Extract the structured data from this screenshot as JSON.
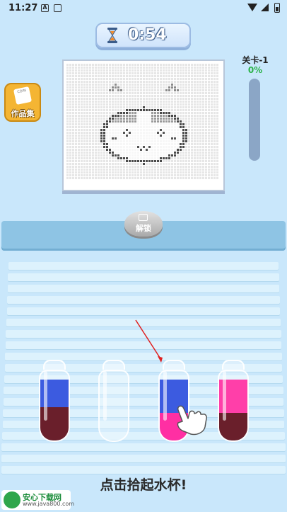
{
  "status_bar": {
    "time": "11:27",
    "icon_a": "A",
    "icons": [
      "notification-a-icon",
      "screenshot-icon",
      "wifi-icon",
      "signal-icon",
      "battery-icon"
    ]
  },
  "timer": {
    "text": "0:54",
    "icon": "hourglass-icon"
  },
  "gallery_button": {
    "label": "作品集",
    "icon": "coin-book-icon",
    "badge": "COIN"
  },
  "level": {
    "label": "关卡-1",
    "percent_text": "0%",
    "progress": 0
  },
  "unlock_button": {
    "label": "解锁",
    "icon": "video-icon"
  },
  "tubes": [
    {
      "layers": [
        {
          "color": "#6a1f2b",
          "fraction": 0.55
        },
        {
          "color": "#3c5be0",
          "fraction": 0.45
        }
      ]
    },
    {
      "layers": []
    },
    {
      "layers": [
        {
          "color": "#ff2fa3",
          "fraction": 0.45
        },
        {
          "color": "#3c5be0",
          "fraction": 0.55
        }
      ]
    },
    {
      "layers": [
        {
          "color": "#6a1f2b",
          "fraction": 0.45
        },
        {
          "color": "#ff3fa9",
          "fraction": 0.55
        }
      ]
    }
  ],
  "hint": "点击拾起水杯!",
  "watermark": {
    "name": "安心下载网",
    "url": "www.java800.com",
    "logo_text": "安心"
  },
  "colors": {
    "background": "#c9e7fb",
    "accent_green": "#2cb34a",
    "shelf": "#8ec4e4"
  }
}
